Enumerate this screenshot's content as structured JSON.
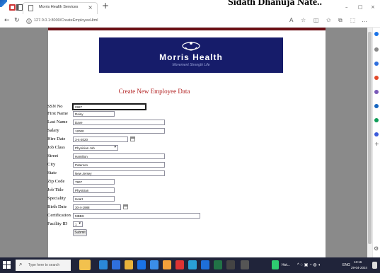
{
  "window": {
    "tab_title": "Morris Health Services",
    "tab_close": "×",
    "new_tab": "+",
    "overlay_text": "Sidath Dhanuja Nate..",
    "minimize": "–",
    "maximize": "□",
    "close": "×"
  },
  "addressbar": {
    "url": "127.0.0.1:8000/CreateEmployeeHtml",
    "back": "←",
    "refresh": "↻"
  },
  "logo": {
    "name": "Morris Health",
    "tagline": "Movement Strength Life"
  },
  "form": {
    "title": "Create New Employee Data",
    "fields": {
      "ssn": {
        "label": "SSN No",
        "value": "0987"
      },
      "first_name": {
        "label": "First Name",
        "value": "Rainy"
      },
      "last_name": {
        "label": "Last Name",
        "value": "Dave"
      },
      "salary": {
        "label": "Salary",
        "value": "12000"
      },
      "hire_date": {
        "label": "Hire Date",
        "value": "3-4-2020"
      },
      "job_class": {
        "label": "Job Class",
        "value": "Physician Job"
      },
      "street": {
        "label": "Street",
        "value": "Hamilton"
      },
      "city": {
        "label": "City",
        "value": "Paterson"
      },
      "state": {
        "label": "State",
        "value": "New Jersey"
      },
      "zip_code": {
        "label": "Zip Code",
        "value": "7907"
      },
      "job_title": {
        "label": "Job Title",
        "value": "Physician"
      },
      "speciality": {
        "label": "Speciality",
        "value": "Heart"
      },
      "birth_date": {
        "label": "Birth Date",
        "value": "30-4-1988"
      },
      "certification": {
        "label": "Certification",
        "value": "MBBS"
      },
      "facility_id": {
        "label": "Facility ID",
        "value": "1"
      }
    },
    "submit_label": "Submit"
  },
  "taskbar": {
    "search_placeholder": "Type here to search",
    "tray_app": "Hot...",
    "language": "ENG",
    "time": "13:16",
    "date": "29-04-2024"
  },
  "colors": {
    "logo_bg": "#161c6a",
    "title_red": "#b22222",
    "header_bar": "#6b0f14",
    "taskbar_bg": "#20243a"
  }
}
